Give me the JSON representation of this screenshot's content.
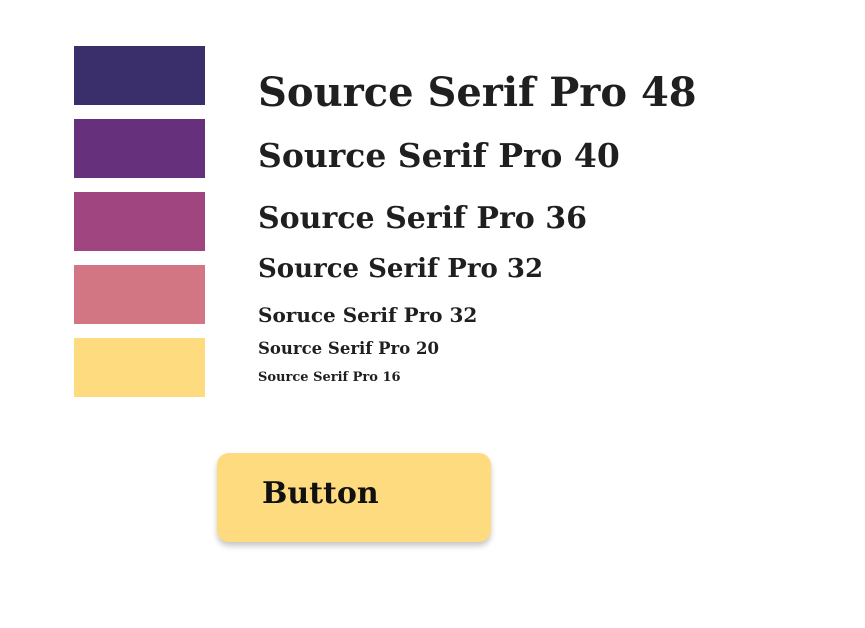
{
  "palette": [
    {
      "name": "swatch-1",
      "color": "#3a2f6b"
    },
    {
      "name": "swatch-2",
      "color": "#66307c"
    },
    {
      "name": "swatch-3",
      "color": "#a0457f"
    },
    {
      "name": "swatch-4",
      "color": "#d17682"
    },
    {
      "name": "swatch-5",
      "color": "#ffdb80"
    }
  ],
  "type_samples": [
    "Source Serif Pro 48",
    "Source Serif Pro 40",
    "Source Serif Pro 36",
    "Source Serif Pro 32",
    "Soruce Serif Pro 32",
    "Source Serif Pro 20",
    "Source Serif Pro 16"
  ],
  "button": {
    "label": "Button",
    "color": "#ffdb80"
  }
}
